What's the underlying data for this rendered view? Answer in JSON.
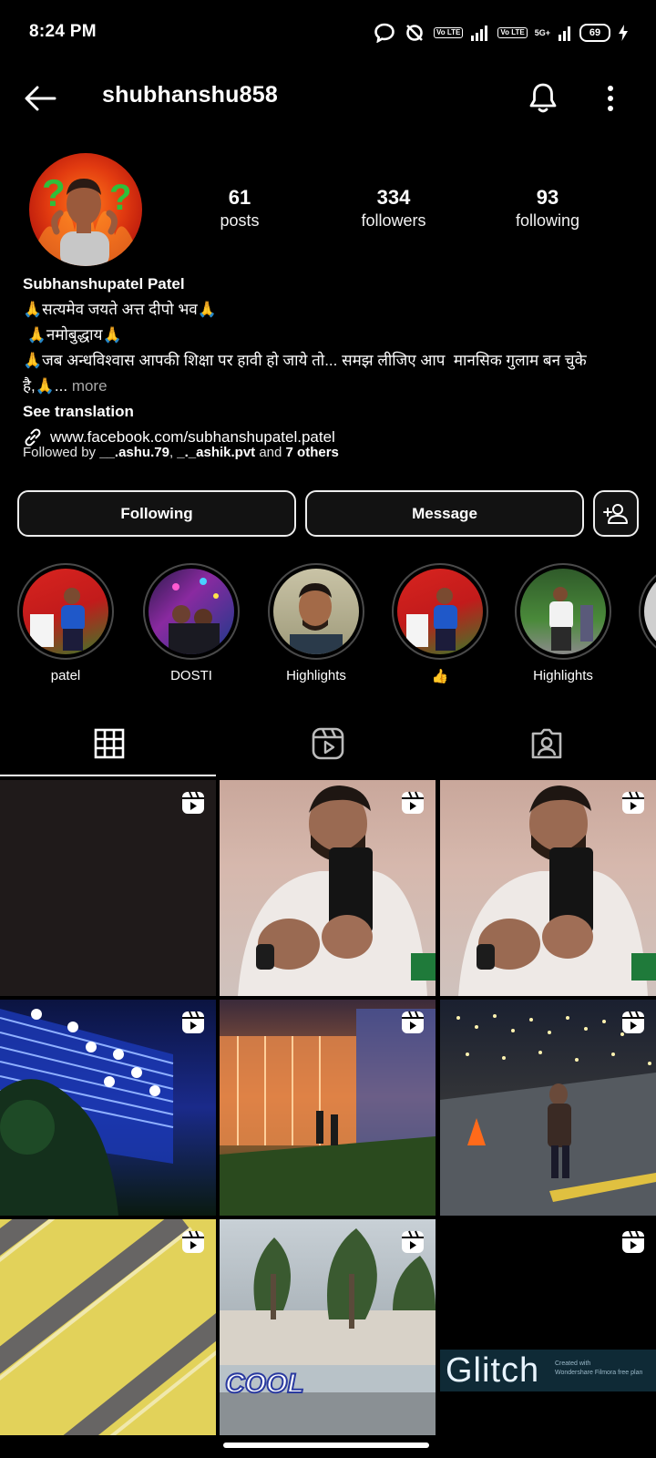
{
  "status_bar": {
    "time": "8:24 PM",
    "volte1": "Vo LTE",
    "volte2": "Vo LTE",
    "net": "5G+",
    "battery": "69"
  },
  "header": {
    "username": "shubhanshu858"
  },
  "profile": {
    "stats": [
      {
        "value": "61",
        "label": "posts"
      },
      {
        "value": "334",
        "label": "followers"
      },
      {
        "value": "93",
        "label": "following"
      }
    ],
    "display_name": "Subhanshupatel Patel",
    "bio_lines": [
      "🙏सत्यमेव जयते अत्त दीपो भव🙏",
      " 🙏नमोबुद्धाय🙏",
      "🙏जब अन्धविश्वास आपकी शिक्षा पर हावी हो जाये तो... समझ लीजिए आप  मानसिक गुलाम बन चुके",
      "है,🙏..."
    ],
    "more": " more",
    "see_translation": "See translation",
    "link": "www.facebook.com/subhanshupatel.patel",
    "followed_by_prefix": "Followed by ",
    "followed_by_user1": "__.ashu.79",
    "followed_by_sep": ", ",
    "followed_by_user2": "_._ashik.pvt",
    "followed_by_and": " and ",
    "followed_by_others": "7 others"
  },
  "actions": {
    "following": "Following",
    "message": "Message"
  },
  "highlights": [
    {
      "label": "patel"
    },
    {
      "label": "DOSTI"
    },
    {
      "label": "Highlights"
    },
    {
      "label": "👍"
    },
    {
      "label": "Highlights"
    }
  ],
  "grid_text": {
    "glitch": "Glitch",
    "filmora_line1": "Created with",
    "filmora_line2": "Wondershare Filmora free plan",
    "cool": "COOL"
  }
}
